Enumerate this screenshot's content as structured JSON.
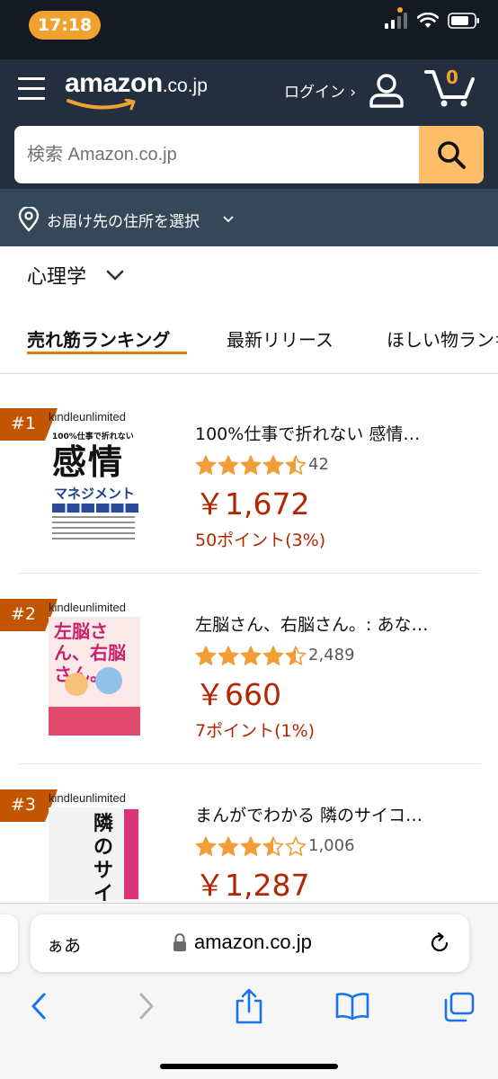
{
  "status_bar": {
    "time": "17:18"
  },
  "header": {
    "logo_main": "amazon",
    "logo_tld": ".co.jp",
    "login_label": "ログイン ›",
    "cart_count": "0"
  },
  "search": {
    "placeholder": "検索 Amazon.co.jp"
  },
  "location": {
    "label": "お届け先の住所を選択"
  },
  "category": {
    "label": "心理学"
  },
  "tabs": [
    {
      "label": "売れ筋ランキング",
      "active": true
    },
    {
      "label": "最新リリース"
    },
    {
      "label": "ほしい物ランキング"
    }
  ],
  "items": [
    {
      "rank": "#1",
      "badge_label": "kindleunlimited",
      "cover_title": "感情",
      "cover_subtitle": "マネジメント",
      "cover_top": "100%仕事で折れない",
      "title": "100%仕事で折れない 感情…",
      "rating": 4.5,
      "reviews": "42",
      "price": "￥1,672",
      "points": "50ポイント(3%)"
    },
    {
      "rank": "#2",
      "badge_label": "kindleunlimited",
      "cover_title": "左脳さん、右脳さん。",
      "title": "左脳さん、右脳さん。: あな…",
      "rating": 4.5,
      "reviews": "2,489",
      "price": "￥660",
      "points": "7ポイント(1%)"
    },
    {
      "rank": "#3",
      "badge_label": "kindleunlimited",
      "cover_title": "隣のサイコパス",
      "title": "まんがでわかる 隣のサイコ…",
      "rating": 3.5,
      "reviews": "1,006",
      "price": "￥1,287",
      "points": ""
    }
  ],
  "safari": {
    "aa_label": "ぁあ",
    "url": "amazon.co.jp"
  },
  "colors": {
    "header_bg": "#232f3e",
    "location_bg": "#37475a",
    "search_button": "#febd69",
    "accent": "#e47911",
    "price": "#b12704",
    "rank_badge": "#c45500",
    "star": "#f19e39"
  }
}
